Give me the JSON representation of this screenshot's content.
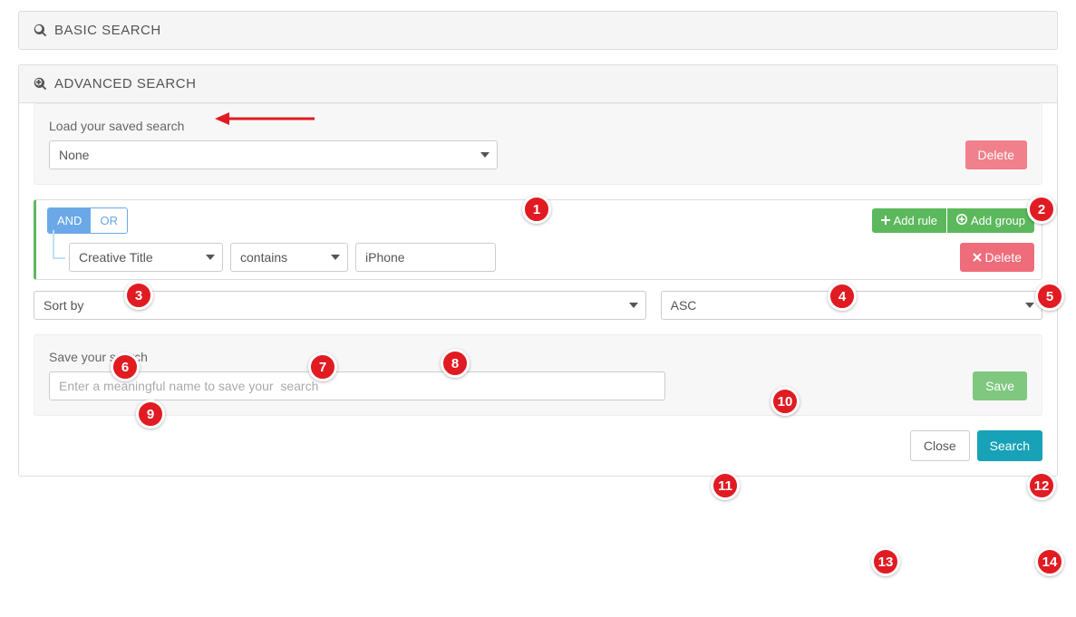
{
  "modal": {
    "close_glyph": "×"
  },
  "basic": {
    "title": "BASIC SEARCH"
  },
  "advanced": {
    "title": "ADVANCED SEARCH",
    "load": {
      "label": "Load your saved search",
      "selected": "None",
      "delete_label": "Delete"
    },
    "qb": {
      "and_label": "AND",
      "or_label": "OR",
      "add_rule_label": "Add rule",
      "add_group_label": "Add group",
      "rule": {
        "field": "Creative Title",
        "operator": "contains",
        "value": "iPhone",
        "delete_label": "Delete"
      }
    },
    "sort": {
      "by_selected": "Sort by",
      "dir_selected": "ASC"
    },
    "save": {
      "label": "Save your search",
      "placeholder": "Enter a meaningful name to save your  search",
      "button": "Save"
    },
    "footer": {
      "close": "Close",
      "search": "Search"
    }
  },
  "annotations": {
    "markers": [
      "1",
      "2",
      "3",
      "4",
      "5",
      "6",
      "7",
      "8",
      "9",
      "10",
      "11",
      "12",
      "13",
      "14"
    ]
  }
}
